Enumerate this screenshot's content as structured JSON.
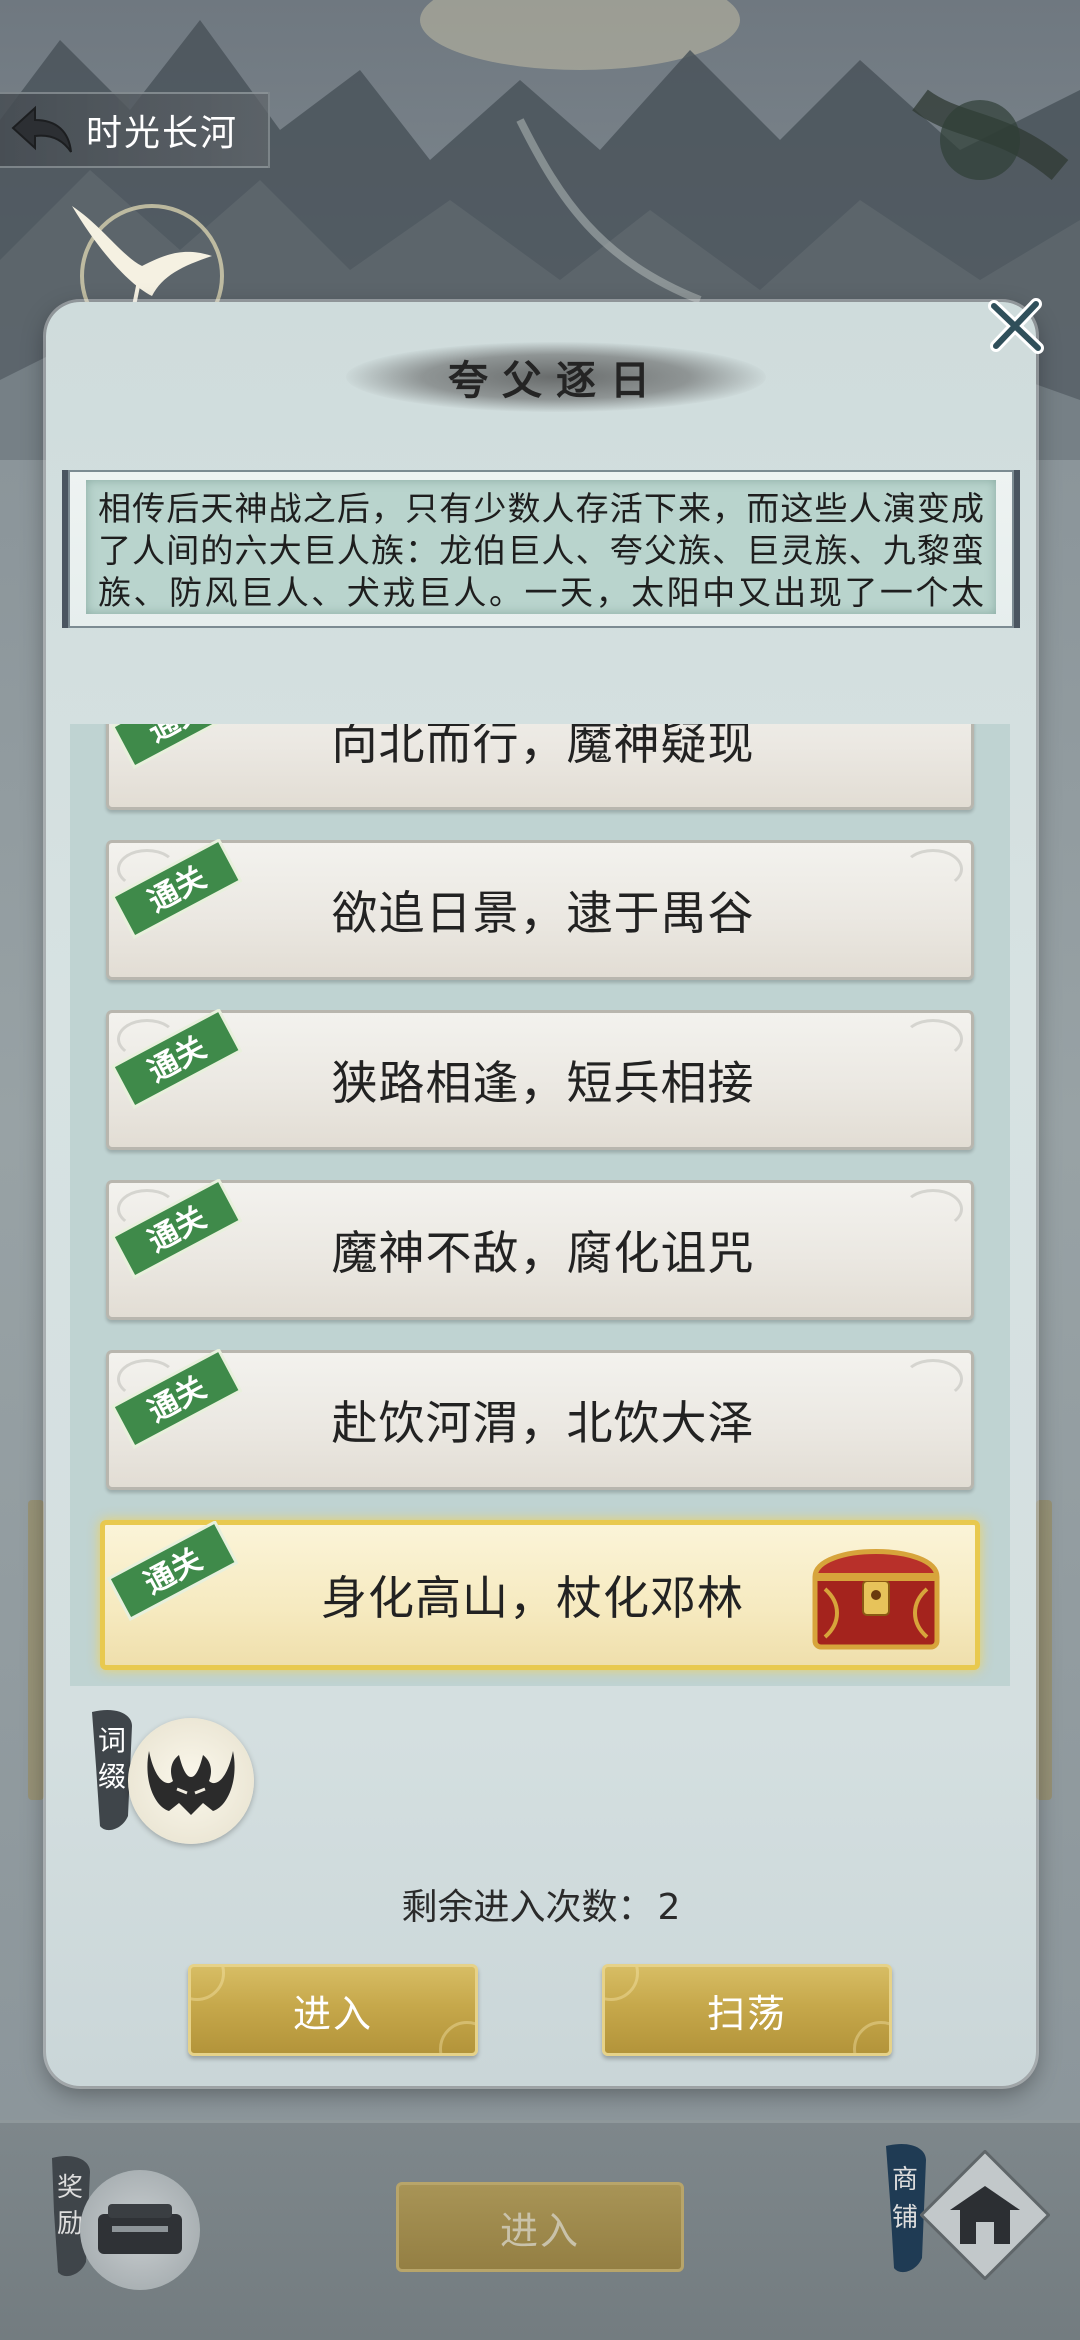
{
  "header": {
    "back_label": "时光长河"
  },
  "dialog": {
    "title": "夸父逐日",
    "story": "相传后天神战之后，只有少数人存活下来，而这些人演变成了人间的六大巨人族：龙伯巨人、夸父族、巨灵族、九黎蛮族、防风巨人、犬戎巨人。一天，太阳中又出现了一个太阳，越来越靠近地面，森林被烧焦，河流被蒸干……",
    "levels": [
      {
        "name": "向北而行，魔神疑现",
        "badge": "通关",
        "cleared": true
      },
      {
        "name": "欲追日景，逮于禺谷",
        "badge": "通关",
        "cleared": true
      },
      {
        "name": "狭路相逢，短兵相接",
        "badge": "通关",
        "cleared": true
      },
      {
        "name": "魔神不敌，腐化诅咒",
        "badge": "通关",
        "cleared": true
      },
      {
        "name": "赴饮河渭，北饮大泽",
        "badge": "通关",
        "cleared": true
      },
      {
        "name": "身化高山，杖化邓林",
        "badge": "通关",
        "cleared": true,
        "selected": true,
        "reward": "treasure-chest-icon"
      }
    ],
    "affix_label": "词缀",
    "remaining_label": "剩余进入次数：",
    "remaining_count": "2",
    "enter_button": "进入",
    "sweep_button": "扫荡"
  },
  "bottom_bar": {
    "reward_label": "奖励",
    "enter_button": "进入",
    "shop_label": "商铺"
  },
  "colors": {
    "gold_button": "#c6a84b",
    "clear_badge": "#3f8a4a",
    "selected_border": "#e8c94f",
    "panel_bg": "#d4dfe0"
  }
}
